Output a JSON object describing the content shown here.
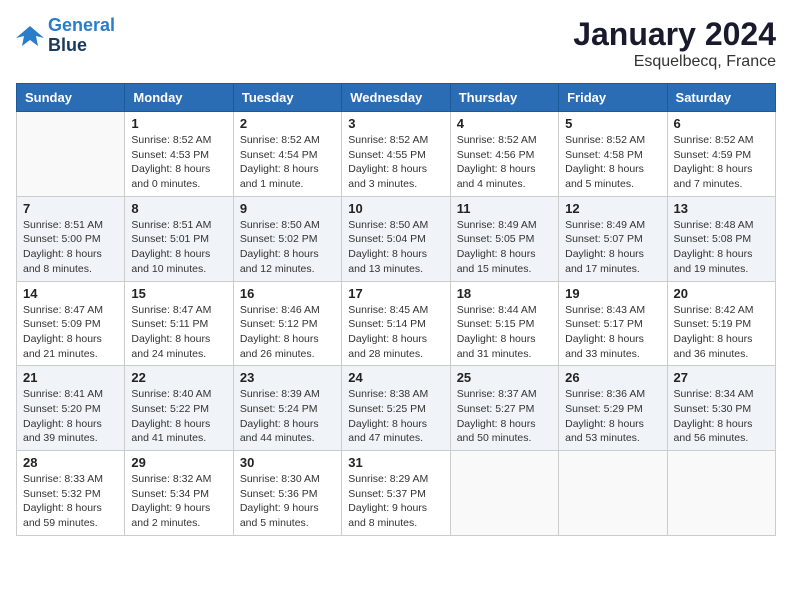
{
  "logo": {
    "line1": "General",
    "line2": "Blue"
  },
  "header": {
    "month": "January 2024",
    "location": "Esquelbecq, France"
  },
  "weekdays": [
    "Sunday",
    "Monday",
    "Tuesday",
    "Wednesday",
    "Thursday",
    "Friday",
    "Saturday"
  ],
  "weeks": [
    [
      {
        "day": "",
        "info": ""
      },
      {
        "day": "1",
        "info": "Sunrise: 8:52 AM\nSunset: 4:53 PM\nDaylight: 8 hours\nand 0 minutes."
      },
      {
        "day": "2",
        "info": "Sunrise: 8:52 AM\nSunset: 4:54 PM\nDaylight: 8 hours\nand 1 minute."
      },
      {
        "day": "3",
        "info": "Sunrise: 8:52 AM\nSunset: 4:55 PM\nDaylight: 8 hours\nand 3 minutes."
      },
      {
        "day": "4",
        "info": "Sunrise: 8:52 AM\nSunset: 4:56 PM\nDaylight: 8 hours\nand 4 minutes."
      },
      {
        "day": "5",
        "info": "Sunrise: 8:52 AM\nSunset: 4:58 PM\nDaylight: 8 hours\nand 5 minutes."
      },
      {
        "day": "6",
        "info": "Sunrise: 8:52 AM\nSunset: 4:59 PM\nDaylight: 8 hours\nand 7 minutes."
      }
    ],
    [
      {
        "day": "7",
        "info": "Sunrise: 8:51 AM\nSunset: 5:00 PM\nDaylight: 8 hours\nand 8 minutes."
      },
      {
        "day": "8",
        "info": "Sunrise: 8:51 AM\nSunset: 5:01 PM\nDaylight: 8 hours\nand 10 minutes."
      },
      {
        "day": "9",
        "info": "Sunrise: 8:50 AM\nSunset: 5:02 PM\nDaylight: 8 hours\nand 12 minutes."
      },
      {
        "day": "10",
        "info": "Sunrise: 8:50 AM\nSunset: 5:04 PM\nDaylight: 8 hours\nand 13 minutes."
      },
      {
        "day": "11",
        "info": "Sunrise: 8:49 AM\nSunset: 5:05 PM\nDaylight: 8 hours\nand 15 minutes."
      },
      {
        "day": "12",
        "info": "Sunrise: 8:49 AM\nSunset: 5:07 PM\nDaylight: 8 hours\nand 17 minutes."
      },
      {
        "day": "13",
        "info": "Sunrise: 8:48 AM\nSunset: 5:08 PM\nDaylight: 8 hours\nand 19 minutes."
      }
    ],
    [
      {
        "day": "14",
        "info": "Sunrise: 8:47 AM\nSunset: 5:09 PM\nDaylight: 8 hours\nand 21 minutes."
      },
      {
        "day": "15",
        "info": "Sunrise: 8:47 AM\nSunset: 5:11 PM\nDaylight: 8 hours\nand 24 minutes."
      },
      {
        "day": "16",
        "info": "Sunrise: 8:46 AM\nSunset: 5:12 PM\nDaylight: 8 hours\nand 26 minutes."
      },
      {
        "day": "17",
        "info": "Sunrise: 8:45 AM\nSunset: 5:14 PM\nDaylight: 8 hours\nand 28 minutes."
      },
      {
        "day": "18",
        "info": "Sunrise: 8:44 AM\nSunset: 5:15 PM\nDaylight: 8 hours\nand 31 minutes."
      },
      {
        "day": "19",
        "info": "Sunrise: 8:43 AM\nSunset: 5:17 PM\nDaylight: 8 hours\nand 33 minutes."
      },
      {
        "day": "20",
        "info": "Sunrise: 8:42 AM\nSunset: 5:19 PM\nDaylight: 8 hours\nand 36 minutes."
      }
    ],
    [
      {
        "day": "21",
        "info": "Sunrise: 8:41 AM\nSunset: 5:20 PM\nDaylight: 8 hours\nand 39 minutes."
      },
      {
        "day": "22",
        "info": "Sunrise: 8:40 AM\nSunset: 5:22 PM\nDaylight: 8 hours\nand 41 minutes."
      },
      {
        "day": "23",
        "info": "Sunrise: 8:39 AM\nSunset: 5:24 PM\nDaylight: 8 hours\nand 44 minutes."
      },
      {
        "day": "24",
        "info": "Sunrise: 8:38 AM\nSunset: 5:25 PM\nDaylight: 8 hours\nand 47 minutes."
      },
      {
        "day": "25",
        "info": "Sunrise: 8:37 AM\nSunset: 5:27 PM\nDaylight: 8 hours\nand 50 minutes."
      },
      {
        "day": "26",
        "info": "Sunrise: 8:36 AM\nSunset: 5:29 PM\nDaylight: 8 hours\nand 53 minutes."
      },
      {
        "day": "27",
        "info": "Sunrise: 8:34 AM\nSunset: 5:30 PM\nDaylight: 8 hours\nand 56 minutes."
      }
    ],
    [
      {
        "day": "28",
        "info": "Sunrise: 8:33 AM\nSunset: 5:32 PM\nDaylight: 8 hours\nand 59 minutes."
      },
      {
        "day": "29",
        "info": "Sunrise: 8:32 AM\nSunset: 5:34 PM\nDaylight: 9 hours\nand 2 minutes."
      },
      {
        "day": "30",
        "info": "Sunrise: 8:30 AM\nSunset: 5:36 PM\nDaylight: 9 hours\nand 5 minutes."
      },
      {
        "day": "31",
        "info": "Sunrise: 8:29 AM\nSunset: 5:37 PM\nDaylight: 9 hours\nand 8 minutes."
      },
      {
        "day": "",
        "info": ""
      },
      {
        "day": "",
        "info": ""
      },
      {
        "day": "",
        "info": ""
      }
    ]
  ]
}
